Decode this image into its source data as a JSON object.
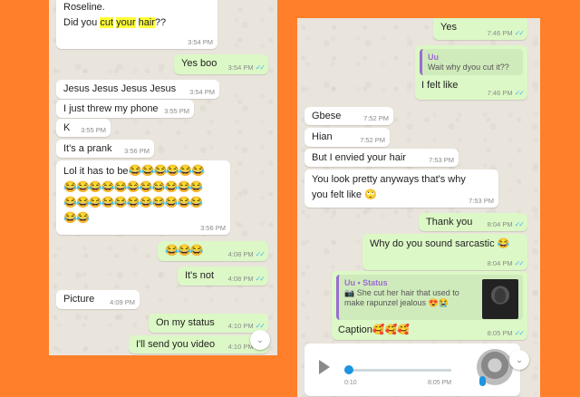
{
  "left_chat": {
    "messages": [
      {
        "text_lines": [
          "Roseline.",
          "Did you "
        ],
        "highlighted": [
          "cut",
          "your",
          "hair"
        ],
        "suffix": "??",
        "time": "3:54 PM"
      },
      {
        "text": "Yes boo",
        "time": "3:54 PM",
        "ticks": "✓✓"
      },
      {
        "text": "Jesus Jesus Jesus Jesus",
        "time": "3:54 PM"
      },
      {
        "text": "I just threw my phone",
        "time": "3:55 PM"
      },
      {
        "text": "K",
        "time": "3:55 PM"
      },
      {
        "text": "It's a prank",
        "time": "3:56 PM"
      },
      {
        "text": "Lol it has to be",
        "emoji_line1": "😂😂😂😂😂😂",
        "emoji_line2": "😂😂😂😂😂😂😂😂😂😂😂",
        "emoji_line3": "😂😂😂😂😂😂😂😂😂😂😂",
        "emoji_line4": "😂😂",
        "time": "3:56 PM"
      },
      {
        "text": "😂😂😂",
        "time": "4:08 PM",
        "ticks": "✓✓"
      },
      {
        "text": "It's not",
        "time": "4:08 PM",
        "ticks": "✓✓"
      },
      {
        "text": "Picture",
        "time": "4:09 PM"
      },
      {
        "text": "On my status",
        "time": "4:10 PM",
        "ticks": "✓✓"
      },
      {
        "text": "I'll send you video",
        "time": "4:10 PM",
        "ticks": "✓✓"
      }
    ],
    "scroll_icon": "chevron-down-icon"
  },
  "right_chat": {
    "messages": [
      {
        "text": "Yes",
        "time": "7:46 PM",
        "ticks": "✓✓"
      },
      {
        "quote_sender": "Uu",
        "quote_text": "Wait why dyou cut it??",
        "text": "I felt like",
        "time": "7:46 PM",
        "ticks": "✓✓"
      },
      {
        "text": "Gbese",
        "time": "7:52 PM"
      },
      {
        "text": "Hian",
        "time": "7:52 PM"
      },
      {
        "text": "But I envied your hair",
        "time": "7:53 PM"
      },
      {
        "text_line1": "You look pretty anyways that's why",
        "text_line2": "you felt like 🙄",
        "time": "7:53 PM"
      },
      {
        "text": "Thank you",
        "time": "8:04 PM",
        "ticks": "✓✓"
      },
      {
        "text": "Why do you sound sarcastic 😂",
        "time": "8:04 PM",
        "ticks": "✓✓"
      },
      {
        "quote_sender": "Uu • Status",
        "quote_line1": "📷 She cut her hair that used to",
        "quote_line2": "make rapunzel jealous 😍😭",
        "text": "Caption🥰🥰🥰",
        "time": "8:05 PM",
        "ticks": "✓✓"
      }
    ],
    "audio": {
      "elapsed": "0:10",
      "time": "8:05 PM"
    },
    "scroll_icon": "chevron-down-icon"
  },
  "colors": {
    "background": "#ff7f2a",
    "incoming": "#ffffff",
    "outgoing": "#dcf8c6",
    "ticks": "#4fb6ec",
    "highlight": "#ffff3a"
  }
}
